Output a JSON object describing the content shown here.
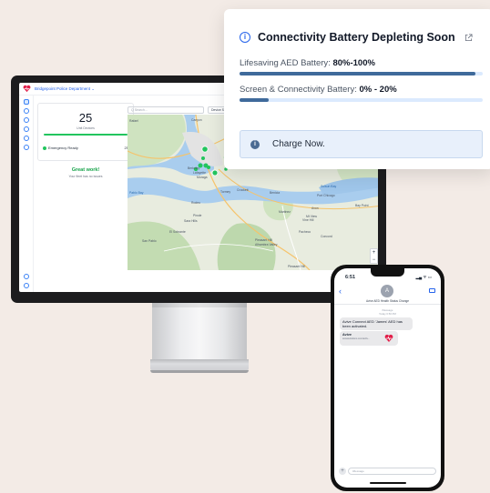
{
  "dashboard": {
    "org_name": "Bridgepoint Police Department ⌄",
    "fleet_count": "25",
    "fleet_label": "Unit Devices",
    "ready_label": "Emergency Ready",
    "ready_count": "25",
    "great_title": "Great work!",
    "great_sub": "Your fleet has no issues",
    "search_placeholder": "Q Search...",
    "filter_label": "Device Statu",
    "map_labels": {
      "canyon": "Canyon",
      "rafael": "Rafael",
      "berkeley": "Berkeley",
      "lafayette": "Lafayette",
      "moraga": "Moraga",
      "pablo_bay": "Pablo Bay",
      "tormey": "Tormey",
      "crockett": "Crockett",
      "benicia": "Benicia",
      "rodeo": "Rodeo",
      "pinole": "Pinole",
      "sara_hills": "Sara Hills",
      "el_sobrante": "El Sobrante",
      "san_pablo": "San Pablo",
      "martinez": "Martinez",
      "avon": "Avon",
      "vine_hill": "Vine Hill",
      "pacheco": "Pacheco",
      "concord": "Concord",
      "pleasant_hill": "Pleasant Hill",
      "alhambra_valley": "Alhambra Valley",
      "suisun_bay": "Suisun Bay",
      "port_chicago": "Port Chicago",
      "bay_point": "Bay Point",
      "mt_view": "Mt View",
      "marina": "Marina"
    },
    "zoom_in": "+",
    "zoom_out": "−"
  },
  "alert": {
    "title": "Connectivity Battery Depleting Soon",
    "aed_label": "Lifesaving AED Battery:",
    "aed_value": "80%-100%",
    "aed_level": 0.97,
    "conn_label": "Screen & Connectivity Battery:",
    "conn_value": "0% - 20%",
    "conn_level": 0.12,
    "action_text": "Charge Now."
  },
  "phone": {
    "time": "6:51",
    "status_icons": "▂▄ ᯤ ▭",
    "contact_initial": "A",
    "contact_name": "Avive AED Health Status Change",
    "thread_meta_1": "iMessage",
    "thread_meta_2": "Today 6:50 PM",
    "message": "Avive Connect AED 'James' AED has been activated.",
    "card_title": "Avive",
    "card_url": "avivesolutions.com/activ...",
    "compose_placeholder": "iMessage",
    "back": "‹",
    "plus": "+"
  },
  "colors": {
    "accent": "#2563eb",
    "bar_fill": "#3f6a9b",
    "bar_track": "#dbeafe",
    "success": "#22c55e",
    "brand_red": "#e11d48"
  }
}
